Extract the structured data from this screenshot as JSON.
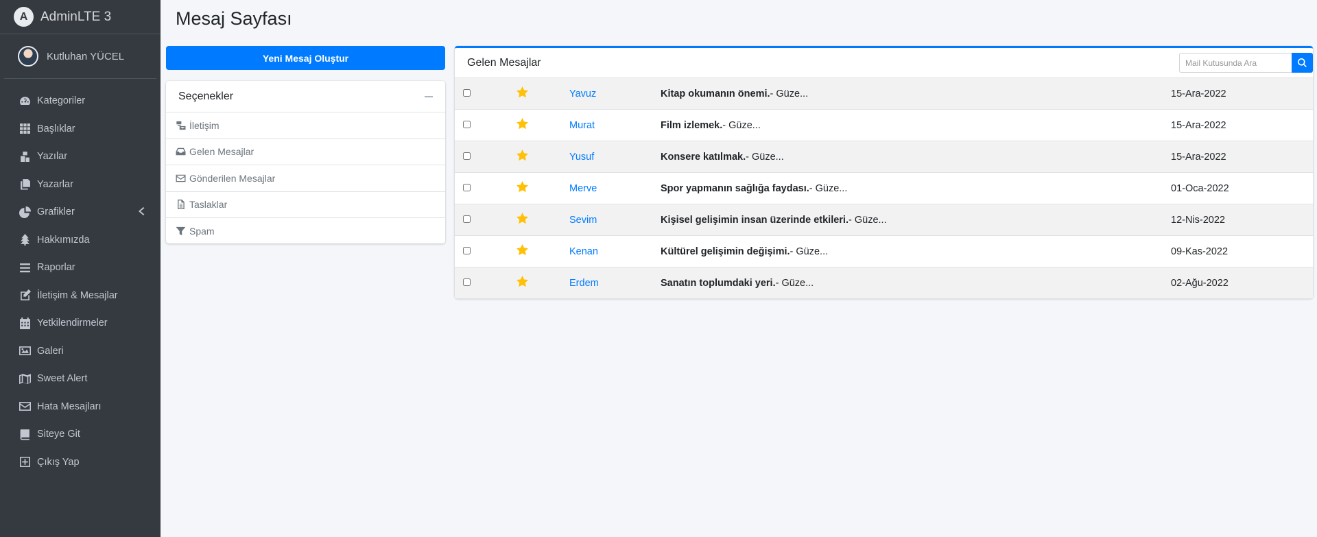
{
  "brand": {
    "name": "AdminLTE 3"
  },
  "user": {
    "name": "Kutluhan YÜCEL"
  },
  "sidebar": {
    "items": [
      {
        "label": "Kategoriler",
        "icon": "dashboard-icon"
      },
      {
        "label": "Başlıklar",
        "icon": "grid-icon"
      },
      {
        "label": "Yazılar",
        "icon": "boxes-icon"
      },
      {
        "label": "Yazarlar",
        "icon": "copy-icon"
      },
      {
        "label": "Grafikler",
        "icon": "pie-chart-icon"
      },
      {
        "label": "Hakkımızda",
        "icon": "tree-icon"
      },
      {
        "label": "Raporlar",
        "icon": "bars-icon"
      },
      {
        "label": "İletişim & Mesajlar",
        "icon": "edit-icon"
      },
      {
        "label": "Yetkilendirmeler",
        "icon": "calendar-icon"
      },
      {
        "label": "Galeri",
        "icon": "image-icon"
      },
      {
        "label": "Sweet Alert",
        "icon": "map-icon"
      },
      {
        "label": "Hata Mesajları",
        "icon": "envelope-icon"
      },
      {
        "label": "Siteye Git",
        "icon": "book-icon"
      },
      {
        "label": "Çıkış Yap",
        "icon": "plus-square-icon"
      }
    ]
  },
  "page": {
    "title": "Mesaj Sayfası"
  },
  "compose": {
    "label": "Yeni Mesaj Oluştur"
  },
  "options": {
    "title": "Seçenekler",
    "items": [
      {
        "label": "İletişim",
        "icon": "mail-bulk-icon"
      },
      {
        "label": "Gelen Mesajlar",
        "icon": "inbox-icon"
      },
      {
        "label": "Gönderilen Mesajlar",
        "icon": "envelope-icon"
      },
      {
        "label": "Taslaklar",
        "icon": "file-icon"
      },
      {
        "label": "Spam",
        "icon": "filter-icon"
      }
    ]
  },
  "inbox": {
    "title": "Gelen Mesajlar",
    "search_placeholder": "Mail Kutusunda Ara",
    "messages": [
      {
        "from": "Yavuz",
        "subject": "Kitap okumanın önemi.",
        "preview": "- Güze...",
        "date": "15-Ara-2022"
      },
      {
        "from": "Murat",
        "subject": "Film izlemek.",
        "preview": "- Güze...",
        "date": "15-Ara-2022"
      },
      {
        "from": "Yusuf",
        "subject": "Konsere katılmak.",
        "preview": "- Güze...",
        "date": "15-Ara-2022"
      },
      {
        "from": "Merve",
        "subject": "Spor yapmanın sağlığa faydası.",
        "preview": "- Güze...",
        "date": "01-Oca-2022"
      },
      {
        "from": "Sevim",
        "subject": "Kişisel gelişimin insan üzerinde etkileri.",
        "preview": "- Güze...",
        "date": "12-Nis-2022"
      },
      {
        "from": "Kenan",
        "subject": "Kültürel gelişimin değişimi.",
        "preview": "- Güze...",
        "date": "09-Kas-2022"
      },
      {
        "from": "Erdem",
        "subject": "Sanatın toplumdaki yeri.",
        "preview": "- Güze...",
        "date": "02-Ağu-2022"
      }
    ]
  },
  "colors": {
    "sidebar_bg": "#343a40",
    "primary": "#007bff",
    "star": "#ffc107",
    "page_bg": "#f4f6f9"
  }
}
